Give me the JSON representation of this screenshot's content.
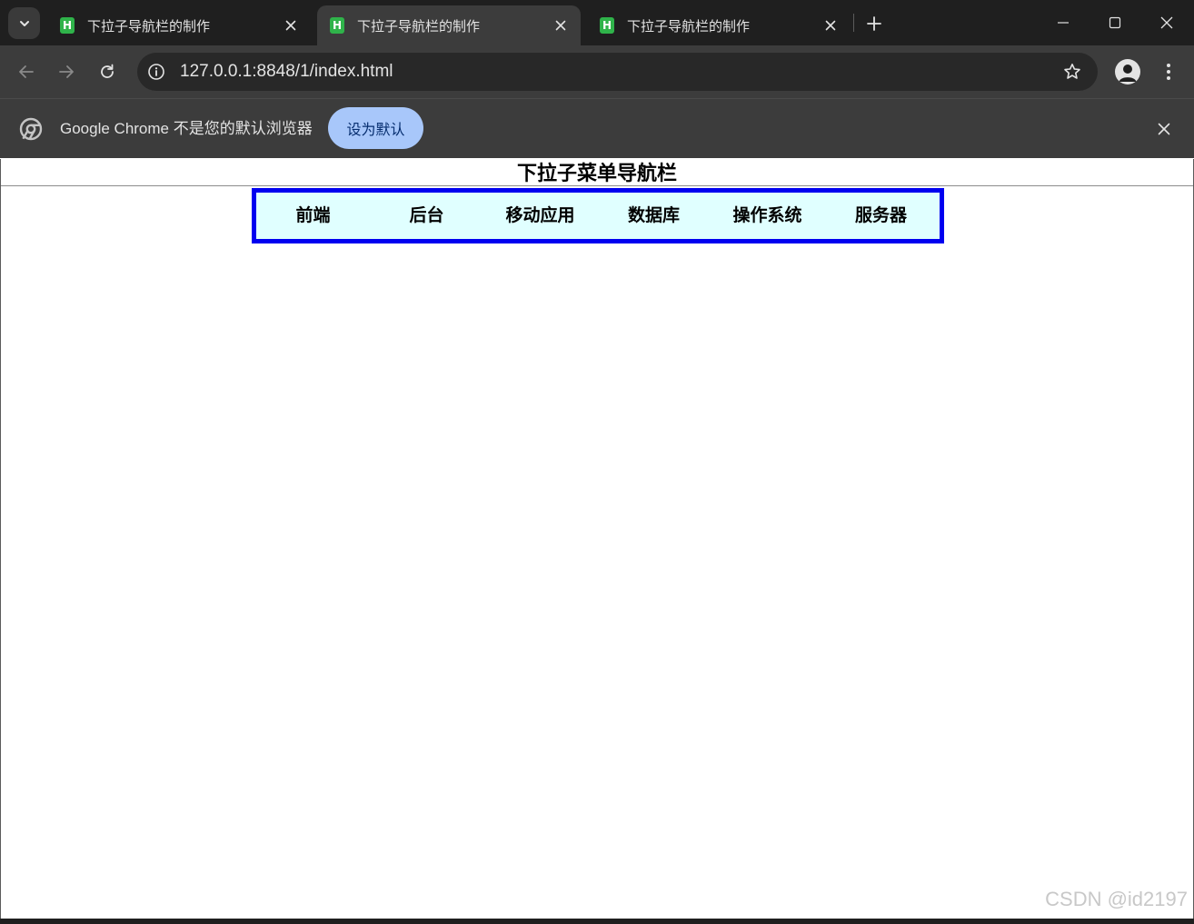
{
  "browser": {
    "tabs": [
      {
        "title": "下拉子导航栏的制作",
        "favicon": "H",
        "active": false
      },
      {
        "title": "下拉子导航栏的制作",
        "favicon": "H",
        "active": true
      },
      {
        "title": "下拉子导航栏的制作",
        "favicon": "H",
        "active": false
      }
    ],
    "url": "127.0.0.1:8848/1/index.html",
    "infobar": {
      "message": "Google Chrome 不是您的默认浏览器",
      "button_label": "设为默认"
    }
  },
  "page": {
    "heading": "下拉子菜单导航栏",
    "nav_items": [
      "前端",
      "后台",
      "移动应用",
      "数据库",
      "操作系统",
      "服务器"
    ]
  },
  "watermark": "CSDN @id2197",
  "colors": {
    "tabstrip_bg": "#1f1f1f",
    "toolbar_bg": "#3c3c3c",
    "infobar_button_bg": "#a8c7fa",
    "nav_bg": "#e0ffff",
    "nav_border": "#0000f0",
    "favicon_green": "#2fb34a"
  },
  "icons": {
    "tab_search": "chevron-down-icon",
    "tab_close": "close-icon",
    "new_tab": "plus-icon",
    "minimize": "minimize-icon",
    "maximize": "maximize-icon",
    "window_close": "close-icon",
    "back": "back-arrow-icon",
    "forward": "forward-arrow-icon",
    "reload": "reload-icon",
    "site_info": "info-icon",
    "bookmark": "star-icon",
    "profile": "profile-icon",
    "menu": "kebab-menu-icon",
    "chrome": "chrome-logo-icon"
  }
}
